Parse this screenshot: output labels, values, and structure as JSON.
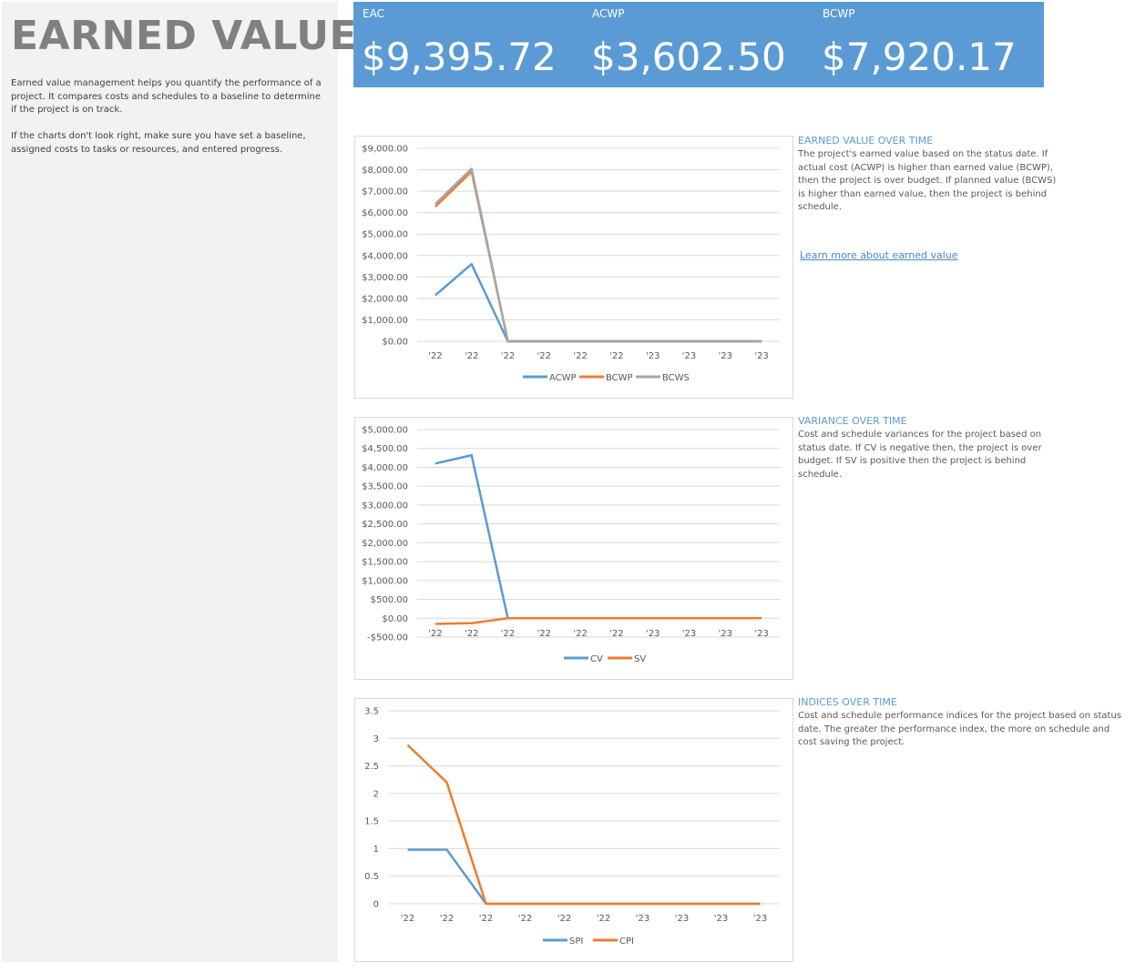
{
  "sidebar": {
    "title": "EARNED VALUE",
    "intro1": "Earned value management helps you quantify the performance of a project. It compares costs and schedules to a baseline to determine if the project is on track.",
    "intro2": "If the charts don't look right, make sure you have set a baseline, assigned costs to tasks or resources, and entered progress."
  },
  "kpis": [
    {
      "label": "EAC",
      "value": "$9,395.72"
    },
    {
      "label": "ACWP",
      "value": "$3,602.50"
    },
    {
      "label": "BCWP",
      "value": "$7,920.17"
    }
  ],
  "sections": {
    "earned": {
      "title": "EARNED VALUE OVER TIME",
      "text": "The project's earned value based on the status date.  If actual cost (ACWP) is higher than earned value (BCWP), then the project is over budget.  If planned value (BCWS) is higher than earned value, then the project is behind schedule.",
      "link": "Learn more about earned value"
    },
    "variance": {
      "title": "VARIANCE OVER TIME",
      "text": "Cost and schedule variances for the project based on status date.  If CV is negative then, the project is over budget.  If SV is positive then the project is behind schedule."
    },
    "indices": {
      "title": "INDICES OVER TIME",
      "text": "Cost and schedule performance indices for the project based on status date.  The greater the performance index, the more on schedule and cost saving the project."
    }
  },
  "colors": {
    "blue": "#5b9bd5",
    "orange": "#ed7d31",
    "gray": "#a5a5a5",
    "kpi_bg": "#5b9bd5",
    "sidebar_bg": "#f2f2f2"
  },
  "chart_data": [
    {
      "type": "line",
      "title": "",
      "categories": [
        "'22",
        "'22",
        "'22",
        "'22",
        "'22",
        "'22",
        "'23",
        "'23",
        "'23",
        "'23"
      ],
      "ylim": [
        0,
        9000
      ],
      "yticks": [
        0,
        1000,
        2000,
        3000,
        4000,
        5000,
        6000,
        7000,
        8000,
        9000
      ],
      "ytick_labels": [
        "$0.00",
        "$1,000.00",
        "$2,000.00",
        "$3,000.00",
        "$4,000.00",
        "$5,000.00",
        "$6,000.00",
        "$7,000.00",
        "$8,000.00",
        "$9,000.00"
      ],
      "grid": true,
      "legend": "bottom",
      "series": [
        {
          "name": "ACWP",
          "color": "#5b9bd5",
          "values": [
            2150,
            3600,
            0,
            0,
            0,
            0,
            0,
            0,
            0,
            0
          ]
        },
        {
          "name": "BCWP",
          "color": "#ed7d31",
          "values": [
            6280,
            7920,
            0,
            0,
            0,
            0,
            0,
            0,
            0,
            0
          ]
        },
        {
          "name": "BCWS",
          "color": "#a5a5a5",
          "values": [
            6400,
            8050,
            0,
            0,
            0,
            0,
            0,
            0,
            0,
            0
          ]
        }
      ]
    },
    {
      "type": "line",
      "title": "",
      "categories": [
        "'22",
        "'22",
        "'22",
        "'22",
        "'22",
        "'22",
        "'23",
        "'23",
        "'23",
        "'23"
      ],
      "ylim": [
        -500,
        5000
      ],
      "yticks": [
        -500,
        0,
        500,
        1000,
        1500,
        2000,
        2500,
        3000,
        3500,
        4000,
        4500,
        5000
      ],
      "ytick_labels": [
        "-$500.00",
        "$0.00",
        "$500.00",
        "$1,000.00",
        "$1,500.00",
        "$2,000.00",
        "$2,500.00",
        "$3,000.00",
        "$3,500.00",
        "$4,000.00",
        "$4,500.00",
        "$5,000.00"
      ],
      "grid": true,
      "legend": "bottom",
      "series": [
        {
          "name": "CV",
          "color": "#5b9bd5",
          "values": [
            4100,
            4320,
            0,
            0,
            0,
            0,
            0,
            0,
            0,
            0
          ]
        },
        {
          "name": "SV",
          "color": "#ed7d31",
          "values": [
            -150,
            -130,
            0,
            0,
            0,
            0,
            0,
            0,
            0,
            0
          ]
        }
      ]
    },
    {
      "type": "line",
      "title": "",
      "categories": [
        "'22",
        "'22",
        "'22",
        "'22",
        "'22",
        "'22",
        "'23",
        "'23",
        "'23",
        "'23"
      ],
      "ylim": [
        0,
        3.5
      ],
      "yticks": [
        0,
        0.5,
        1,
        1.5,
        2,
        2.5,
        3,
        3.5
      ],
      "ytick_labels": [
        "0",
        "0.5",
        "1",
        "1.5",
        "2",
        "2.5",
        "3",
        "3.5"
      ],
      "grid": true,
      "legend": "bottom",
      "series": [
        {
          "name": "SPI",
          "color": "#5b9bd5",
          "values": [
            0.98,
            0.98,
            0,
            0,
            0,
            0,
            0,
            0,
            0,
            0
          ]
        },
        {
          "name": "CPI",
          "color": "#ed7d31",
          "values": [
            2.88,
            2.2,
            0,
            0,
            0,
            0,
            0,
            0,
            0,
            0
          ]
        }
      ]
    }
  ]
}
